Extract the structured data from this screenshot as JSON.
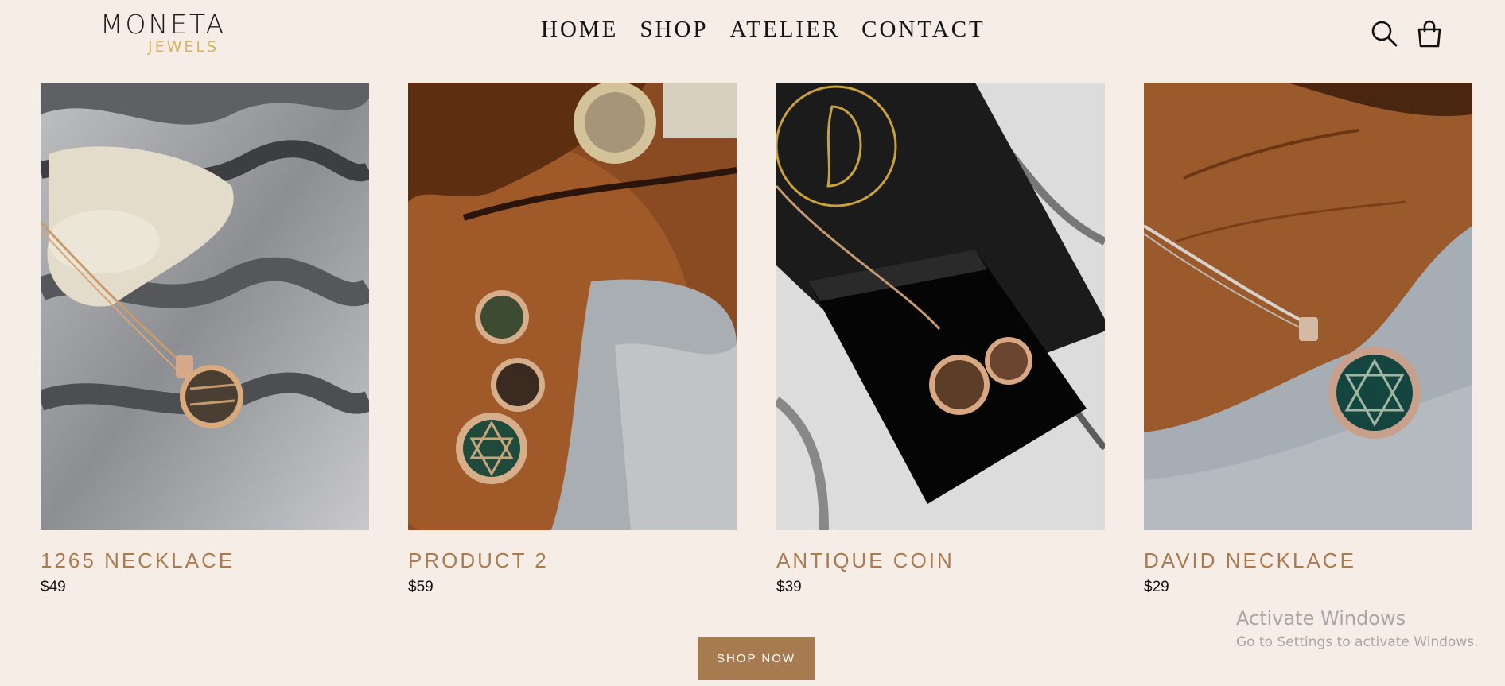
{
  "brand": {
    "name": "MONETA",
    "tagline": "JEWELS"
  },
  "nav": {
    "items": [
      {
        "label": "HOME"
      },
      {
        "label": "SHOP"
      },
      {
        "label": "ATELIER"
      },
      {
        "label": "CONTACT"
      }
    ]
  },
  "header": {
    "search_icon": "search-icon",
    "cart_icon": "shopping-bag-icon"
  },
  "products": [
    {
      "name": "1265 NECKLACE",
      "price": "$49",
      "image_description": "gold necklace on grey marble"
    },
    {
      "name": "PRODUCT 2",
      "price": "$59",
      "image_description": "coin pendants on wood slab"
    },
    {
      "name": "ANTIQUE COIN",
      "price": "$39",
      "image_description": "coin necklace in black gift box"
    },
    {
      "name": "DAVID NECKLACE",
      "price": "$29",
      "image_description": "star of David pendant on wood and stone"
    }
  ],
  "cta": {
    "label": "SHOP NOW"
  },
  "system_watermark": {
    "title": "Activate Windows",
    "subtitle": "Go to Settings to activate Windows."
  },
  "colors": {
    "background": "#f6eee6",
    "accent": "#a87a4f",
    "product_name": "#a97b52",
    "logo_gold": "#d9b25d"
  }
}
